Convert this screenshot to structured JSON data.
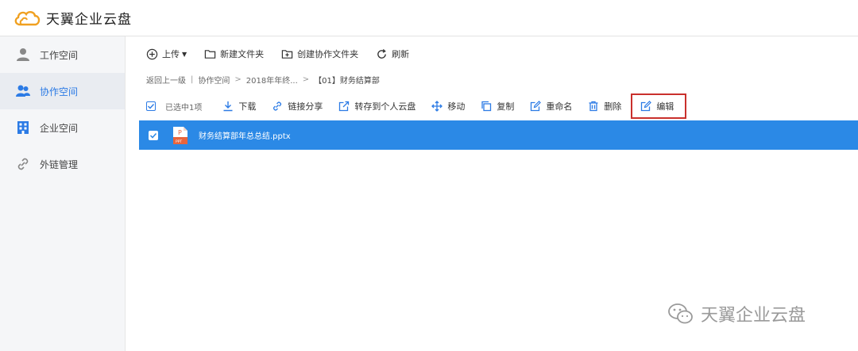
{
  "app": {
    "title": "天翼企业云盘"
  },
  "colors": {
    "accent": "#2b89e6",
    "highlight_border": "#c9302c",
    "logo_orange": "#f0a020"
  },
  "sidebar": {
    "items": [
      {
        "label": "工作空间",
        "icon": "user-icon",
        "active": false
      },
      {
        "label": "协作空间",
        "icon": "users-icon",
        "active": true
      },
      {
        "label": "企业空间",
        "icon": "building-icon",
        "active": false
      },
      {
        "label": "外链管理",
        "icon": "link-icon",
        "active": false
      }
    ]
  },
  "toolbar": {
    "upload": "上传",
    "new_folder": "新建文件夹",
    "create_collab_folder": "创建协作文件夹",
    "refresh": "刷新"
  },
  "breadcrumb": {
    "back": "返回上一级",
    "sep": "|",
    "crumb1": "协作空间",
    "arrow": ">",
    "crumb2": "2018年年终...",
    "current": "【01】财务结算部"
  },
  "actionbar": {
    "selected": "已选中1项",
    "download": "下载",
    "link_share": "链接分享",
    "save_to_personal": "转存到个人云盘",
    "move": "移动",
    "copy": "复制",
    "rename": "重命名",
    "delete": "删除",
    "edit": "编辑"
  },
  "files": [
    {
      "name": "财务结算部年总总结.pptx",
      "icon": "ppt-file-icon",
      "selected": true,
      "icon_label": "P",
      "icon_sublabel": "PPT"
    }
  ],
  "watermark": {
    "text": "天翼企业云盘"
  }
}
